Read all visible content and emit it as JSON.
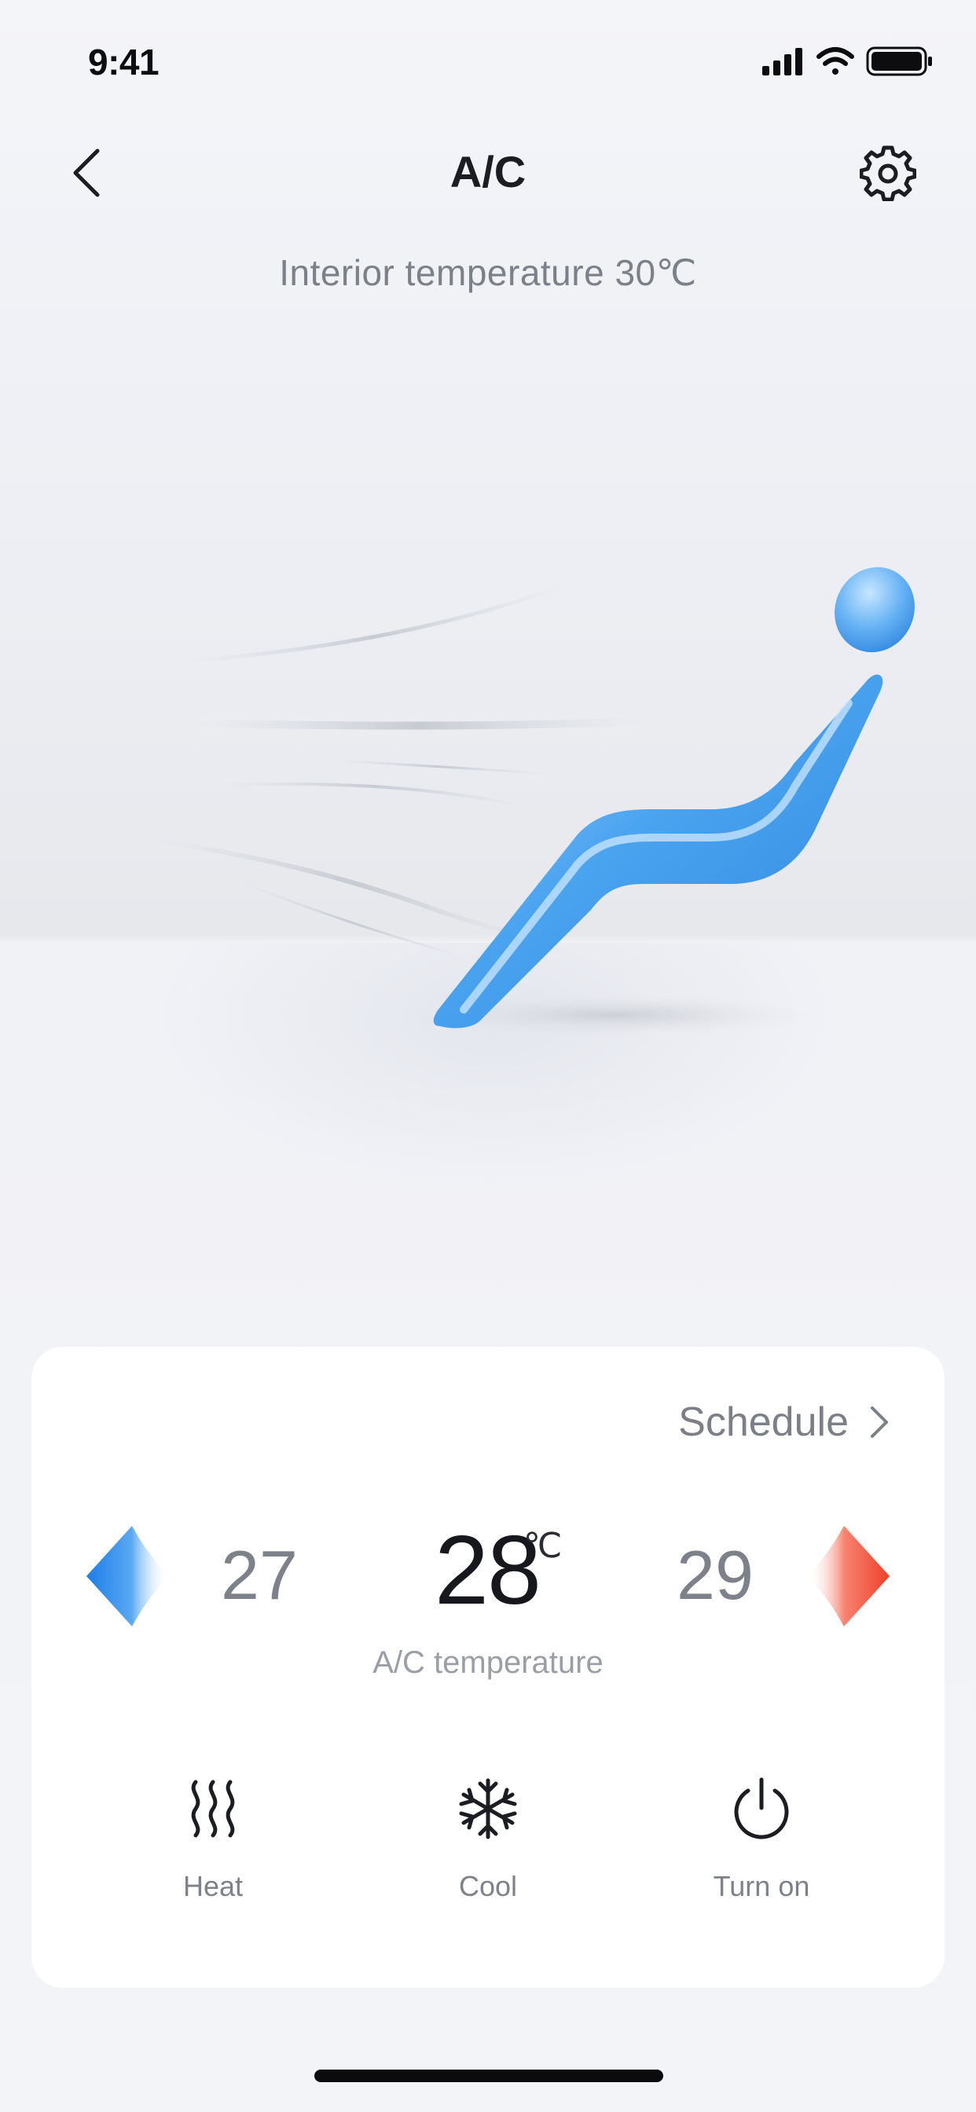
{
  "status_bar": {
    "time": "9:41",
    "icons": [
      "cellular-signal-icon",
      "wifi-icon",
      "battery-icon"
    ]
  },
  "nav": {
    "title": "A/C",
    "back_icon": "chevron-left-icon",
    "settings_icon": "gear-icon"
  },
  "interior": {
    "text": "Interior temperature  30℃",
    "value": 30
  },
  "hero": {
    "icon": "reclining-seat-airflow-illustration"
  },
  "card": {
    "schedule_label": "Schedule",
    "temperature": {
      "previous": "27",
      "current": "28",
      "unit": "℃",
      "next": "29",
      "caption": "A/C temperature",
      "decrease_color": "#3d95f1",
      "increase_color": "#f1533a"
    },
    "modes": [
      {
        "label": "Heat",
        "icon": "heat-waves-icon"
      },
      {
        "label": "Cool",
        "icon": "snowflake-icon"
      },
      {
        "label": "Turn on",
        "icon": "power-icon"
      }
    ]
  }
}
